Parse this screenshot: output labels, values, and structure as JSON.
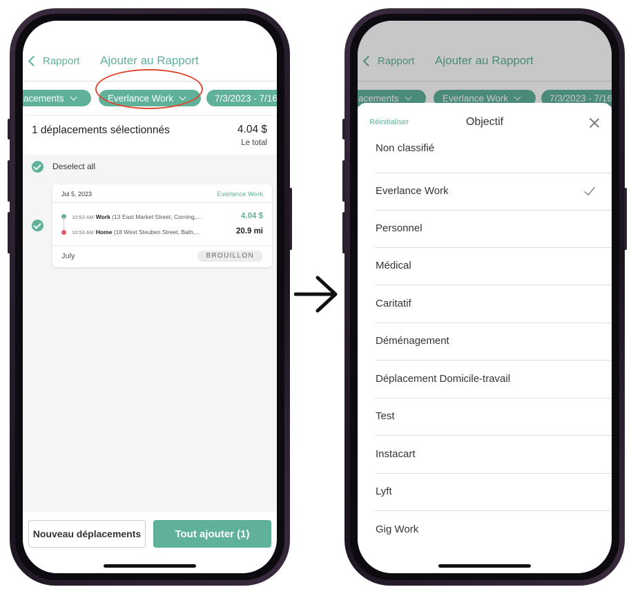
{
  "left_screen": {
    "header": {
      "back_label": "Rapport",
      "title": "Ajouter au Rapport"
    },
    "filters": [
      {
        "label": "lacements"
      },
      {
        "label": "Everlance Work"
      },
      {
        "label": "7/3/2023 - 7/16"
      }
    ],
    "summary": {
      "selected_text": "1 déplacements sélectionnés",
      "amount": "4.04 $",
      "amount_caption": "Le total"
    },
    "deselect_all": "Deselect all",
    "trip": {
      "date": "Jul 5, 2023",
      "purpose": "Everlance Work",
      "start_time": "10:53 AM",
      "start_name": "Work",
      "start_address": "(13 East Market Street, Corning,...",
      "end_time": "10:53 AM",
      "end_name": "Home",
      "end_address": "(18 West Steuben Street, Bath,...",
      "value": "4.04 $",
      "distance": "20.9 mi",
      "month": "July",
      "status": "BROUILLON"
    },
    "buttons": {
      "new": "Nouveau déplacements",
      "add_all": "Tout ajouter (1)"
    }
  },
  "right_screen": {
    "sheet": {
      "reset_label": "Réinitialiser",
      "title": "Objectif",
      "options": [
        {
          "label": "Non classifié",
          "selected": false
        },
        {
          "label": "Everlance Work",
          "selected": true
        },
        {
          "label": "Personnel",
          "selected": false
        },
        {
          "label": "Médical",
          "selected": false
        },
        {
          "label": "Caritatif",
          "selected": false
        },
        {
          "label": "Déménagement",
          "selected": false
        },
        {
          "label": "Déplacement Domicile-travail",
          "selected": false
        },
        {
          "label": "Test",
          "selected": false
        },
        {
          "label": "Instacart",
          "selected": false
        },
        {
          "label": "Lyft",
          "selected": false
        },
        {
          "label": "Gig Work",
          "selected": false
        }
      ]
    }
  },
  "colors": {
    "accent": "#5fb19a",
    "highlight_circle": "#e0462d",
    "start_dot": "#5fb19a",
    "end_dot": "#e05a6a"
  }
}
